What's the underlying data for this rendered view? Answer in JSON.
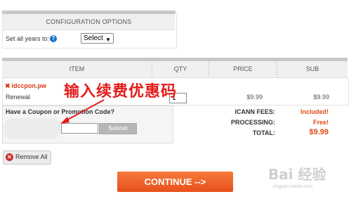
{
  "config": {
    "header": "CONFIGURATION OPTIONS",
    "set_all_label": "Set all years to:",
    "help_icon": "?",
    "select_value": "Select"
  },
  "cart": {
    "columns": [
      "ITEM",
      "QTY",
      "PRICE",
      "SUB"
    ],
    "item": {
      "domain": "idccpon.pw",
      "type": "Renewal",
      "qty": "1",
      "price": "$9.99",
      "sub": "$9.99"
    }
  },
  "coupon": {
    "label": "Have a Coupon or Promotion Code?",
    "input_value": "",
    "submit_label": "Submit"
  },
  "fees": [
    {
      "label": "ICANN FEES:",
      "value": "Included!"
    },
    {
      "label": "PROCESSING:",
      "value": "Free!"
    },
    {
      "label": "TOTAL:",
      "value": "$9.99"
    }
  ],
  "remove_all_label": "Remove All",
  "continue_label": "CONTINUE -->",
  "annotation": "输入续费优惠码",
  "watermark": {
    "main": "Bai 经验",
    "sub": "jingyan.baidu.com"
  },
  "colors": {
    "accent": "#e8501a",
    "link_red": "#d73a12",
    "annot_red": "#e41c1c"
  }
}
